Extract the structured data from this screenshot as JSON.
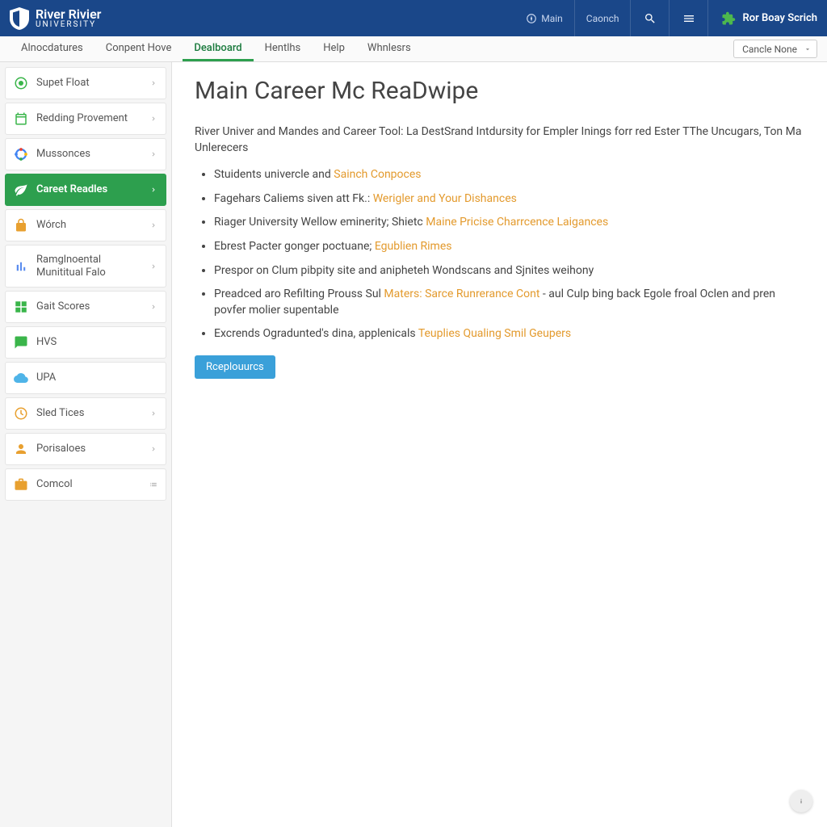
{
  "header": {
    "logo_line1": "River Rivier",
    "logo_line2": "UNIVERSITY",
    "link_main": "Main",
    "link_cancel": "Caonch",
    "right_text": "Ror Boay Scrich"
  },
  "topnav": {
    "items": [
      "Alnocdatures",
      "Conpent Hove",
      "Dealboard",
      "Hentlhs",
      "Help",
      "Whnlesrs"
    ],
    "active_index": 2,
    "select_label": "Cancle None"
  },
  "sidebar": {
    "items": [
      {
        "label": "Supet Float",
        "icon": "target",
        "color": "#3ab54a",
        "chev": true
      },
      {
        "label": "Redding Provement",
        "icon": "calendar",
        "color": "#3ab54a",
        "chev": true
      },
      {
        "label": "Mussonces",
        "icon": "circle-dots",
        "color": "#4285f4",
        "chev": true
      },
      {
        "label": "Careet Readles",
        "icon": "leaf",
        "color": "#fff",
        "chev": true,
        "active": true
      },
      {
        "label": "Wórch",
        "icon": "lock",
        "color": "#e8a030",
        "chev": true
      },
      {
        "label": "Ramglnoental Munititual Falo",
        "icon": "chart",
        "color": "#5b8def",
        "chev": true
      },
      {
        "label": "Gait Scores",
        "icon": "grid",
        "color": "#3ab54a",
        "chev": true
      },
      {
        "label": "HVS",
        "icon": "chat",
        "color": "#3ab54a",
        "chev": false
      },
      {
        "label": "UPA",
        "icon": "cloud",
        "color": "#4fb4e8",
        "chev": false
      },
      {
        "label": "Sled Tices",
        "icon": "clock",
        "color": "#e8a030",
        "chev": true
      },
      {
        "label": "Porisaloes",
        "icon": "person",
        "color": "#e8a030",
        "chev": true
      },
      {
        "label": "Comcol",
        "icon": "briefcase",
        "color": "#e8a030",
        "chev": false,
        "trailing": "list"
      }
    ]
  },
  "content": {
    "title": "Main Career Mc ReaDwipe",
    "intro": "River Univer and Mandes and Career Tool: La DestSrand Intdursity for Empler Inings forr red Ester TThe Uncugars, Ton Ma Unlerecers",
    "bullets": [
      {
        "pre": "Stuidents univercle and ",
        "link": "Sainch Conpoces",
        "post": ""
      },
      {
        "pre": "Fagehars Caliems siven att Fk.: ",
        "link": "Werigler and Your Dishances",
        "post": ""
      },
      {
        "pre": "Riager University Wellow eminerity; Shietc ",
        "link": "Maine Pricise Charrcence Laigances",
        "post": ""
      },
      {
        "pre": "Ebrest Pacter gonger poctuane; ",
        "link": "Egublien Rimes",
        "post": ""
      },
      {
        "pre": "Prespor on Clum pibpity site and anipheteh Wondscans and Sjnites weihony",
        "link": "",
        "post": ""
      },
      {
        "pre": "Preadced aro Refilting Prouss Sul ",
        "link": "Maters: Sarce Runrerance Cont",
        "post": " - aul Culp bing back Egole froal Oclen and pren povfer molier supentable"
      },
      {
        "pre": "Excrends Ogradunted's dina, applenicals ",
        "link": "Teuplies Qualing Smil Geupers",
        "post": ""
      }
    ],
    "button": "Rceplouurcs"
  }
}
